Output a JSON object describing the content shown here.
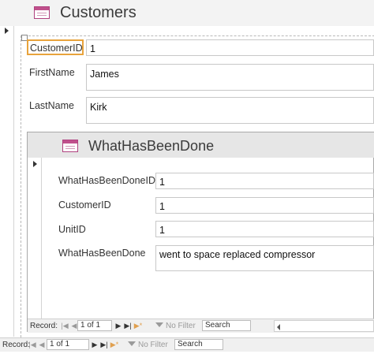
{
  "main_form": {
    "title": "Customers",
    "fields": [
      {
        "label": "CustomerID",
        "value": "1"
      },
      {
        "label": "FirstName",
        "value": "James"
      },
      {
        "label": "LastName",
        "value": "Kirk"
      }
    ]
  },
  "subform": {
    "title": "WhatHasBeenDone",
    "fields": [
      {
        "label": "WhatHasBeenDoneID",
        "value": "1"
      },
      {
        "label": "CustomerID",
        "value": "1"
      },
      {
        "label": "UnitID",
        "value": "1"
      },
      {
        "label": "WhatHasBeenDone",
        "value": "went to space replaced compressor"
      }
    ],
    "nav": {
      "record_label": "Record:",
      "record_value": "1 of 1",
      "filter_label": "No Filter",
      "search_placeholder": "Search"
    }
  },
  "main_nav": {
    "record_label": "Record:",
    "record_value": "1 of 1",
    "filter_label": "No Filter",
    "search_placeholder": "Search"
  },
  "colors": {
    "focus_border": "#e8a33c",
    "form_icon": "#c0508c"
  }
}
